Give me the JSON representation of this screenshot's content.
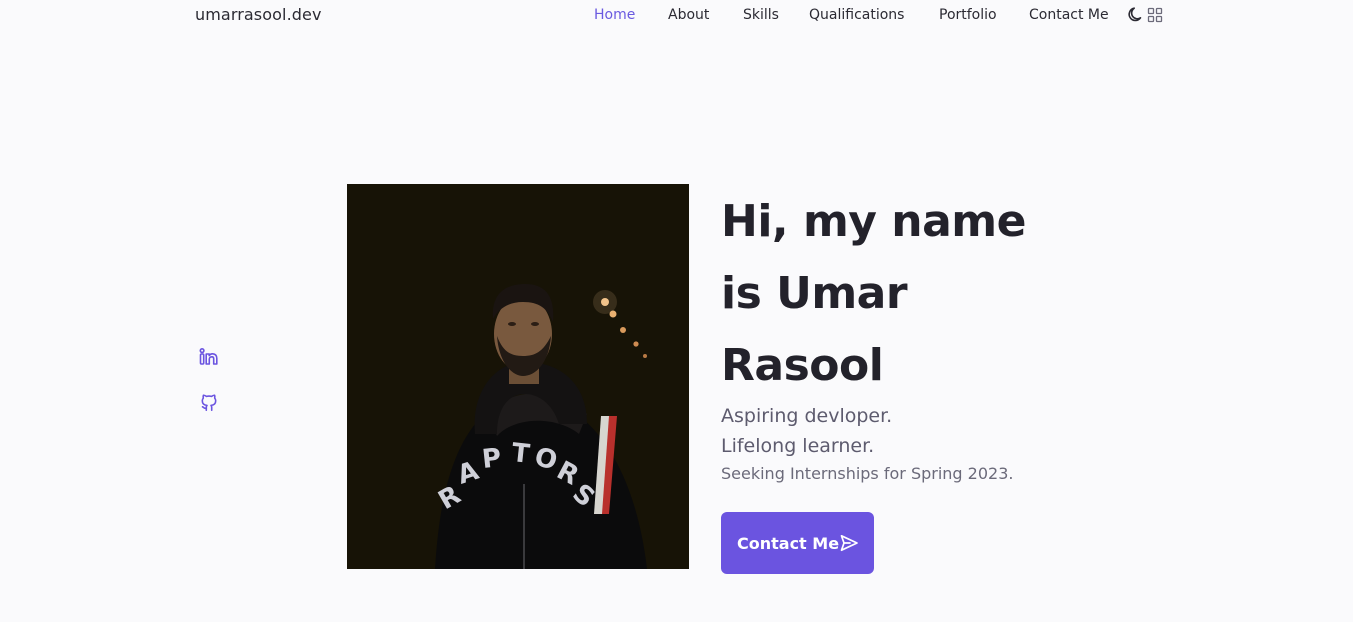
{
  "header": {
    "logo": "umarrasool.dev",
    "nav": [
      {
        "label": "Home",
        "active": true
      },
      {
        "label": "About",
        "active": false
      },
      {
        "label": "Skills",
        "active": false
      },
      {
        "label": "Qualifications",
        "active": false
      },
      {
        "label": "Portfolio",
        "active": false
      },
      {
        "label": "Contact Me",
        "active": false
      }
    ],
    "theme_icon": "moon-icon",
    "menu_icon": "grid-menu-icon"
  },
  "social": {
    "linkedin_icon": "linkedin-icon",
    "github_icon": "github-icon"
  },
  "hero": {
    "title_lines": [
      "Hi, my name",
      "is Umar",
      "Rasool"
    ],
    "subtitle_1": "Aspiring devloper.",
    "subtitle_2": "Lifelong learner.",
    "description": "Seeking Internships for Spring 2023.",
    "cta_label": "Contact Me",
    "cta_icon": "send-icon",
    "photo_jacket_text": "RAPTORS"
  },
  "colors": {
    "accent": "#6b54e0",
    "text": "#23222b",
    "muted": "#5d5b6e",
    "background": "#fafafc"
  }
}
